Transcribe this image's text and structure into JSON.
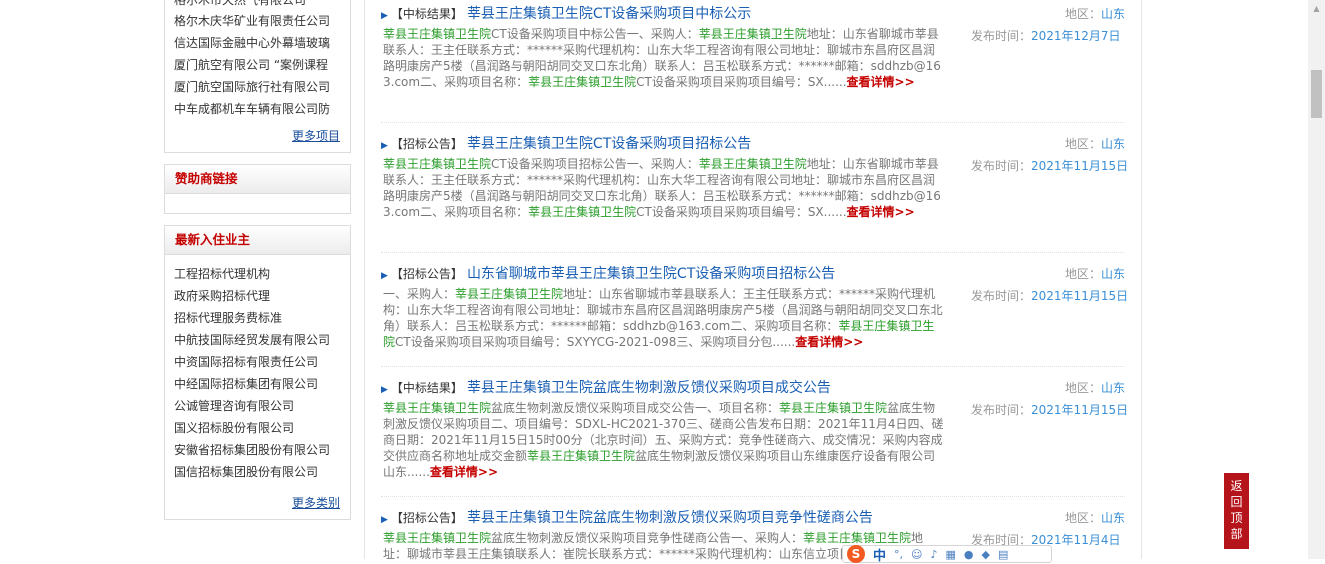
{
  "sidebar": {
    "top_partial": "格尔木市天然气有限公司",
    "top_list": [
      "格尔木庆华矿业有限责任公司",
      "信达国际金融中心外幕墙玻璃",
      "厦门航空有限公司 “案例课程",
      "厦门航空国际旅行社有限公司",
      "中车成都机车车辆有限公司防"
    ],
    "more_projects": "更多项目",
    "sponsor_title": "赞助商链接",
    "new_title": "最新入住业主",
    "new_list": [
      "工程招标代理机构",
      "政府采购招标代理",
      "招标代理服务费标准",
      "中航技国际经贸发展有限公司",
      "中资国际招标有限责任公司",
      "中经国际招标集团有限公司",
      "公诚管理咨询有限公司",
      "国义招标股份有限公司",
      "安徽省招标集团股份有限公司",
      "国信招标集团股份有限公司"
    ],
    "more_categories": "更多类别"
  },
  "labels": {
    "region": "地区：",
    "publish_time": "发布时间：",
    "detail": "查看详情>>",
    "detail_split_a": "查看详",
    "detail_split_b": "情>>"
  },
  "items": [
    {
      "tag": "【中标结果】",
      "title": "莘县王庄集镇卫生院CT设备采购项目中标公示",
      "region": "山东",
      "date": "2021年12月7日",
      "summary": {
        "p1": "莘县王庄集镇卫生院",
        "p2": "CT设备采购项目中标公告一、采购人：",
        "p3": "莘县王庄集镇卫生院",
        "p4": "地址：山东省聊城市莘县联系人：王主任联系方式：******采购代理机构：山东大华工程咨询有限公司地址：聊城市东昌府区昌润路明康房产5楼（昌润路与朝阳胡同交叉口东北角）联系人：吕玉松联系方式：******邮箱：sddhzb@163.com二、采购项目名称：",
        "p5": "莘县王庄集镇卫生院",
        "p6": "CT设备采购项目采购项目编号：SX......"
      }
    },
    {
      "tag": "【招标公告】",
      "title": "莘县王庄集镇卫生院CT设备采购项目招标公告",
      "region": "山东",
      "date": "2021年11月15日",
      "summary": {
        "p1": "莘县王庄集镇卫生院",
        "p2": "CT设备采购项目招标公告一、采购人：",
        "p3": "莘县王庄集镇卫生院",
        "p4": "地址：山东省聊城市莘县联系人：王主任联系方式：******采购代理机构：山东大华工程咨询有限公司地址：聊城市东昌府区昌润路明康房产5楼（昌润路与朝阳胡同交叉口东北角）联系人：吕玉松联系方式：******邮箱：sddhzb@163.com二、采购项目名称：",
        "p5": "莘县王庄集镇卫生院",
        "p6": "CT设备采购项目采购项目编号：SX......"
      }
    },
    {
      "tag": "【招标公告】",
      "title": "山东省聊城市莘县王庄集镇卫生院CT设备采购项目招标公告",
      "region": "山东",
      "date": "2021年11月15日",
      "summary": {
        "p1": "一、采购人：",
        "p2": "莘县王庄集镇卫生院",
        "p3": "地址：山东省聊城市莘县联系人：王主任联系方式：******采购代理机构：山东大华工程咨询有限公司地址：聊城市东昌府区昌润路明康房产5楼（昌润路与朝阳胡同交叉口东北角）联系人：吕玉松联系方式：******邮箱：sddhzb@163.com二、采购项目名称：",
        "p4": "莘县王庄集镇卫生院",
        "p5": "CT设备采购项目采购项目编号：SXYYCG-2021-098三、采购项目分包......"
      }
    },
    {
      "tag": "【中标结果】",
      "title": "莘县王庄集镇卫生院盆底生物刺激反馈仪采购项目成交公告",
      "region": "山东",
      "date": "2021年11月15日",
      "summary": {
        "p1": "莘县王庄集镇卫生院",
        "p2": "盆底生物刺激反馈仪采购项目成交公告一、项目名称：",
        "p3": "莘县王庄集镇卫生院",
        "p4": "盆底生物刺激反馈仪采购项目二、项目编号：SDXL-HC2021-370三、磋商公告发布日期：2021年11月4日四、磋商日期：2021年11月15日15时00分（北京时间）五、采购方式：竞争性磋商六、成交情况：采购内容成交供应商名称地址成交金额",
        "p5": "莘县王庄集镇卫生院",
        "p6": "盆底生物刺激反馈仪采购项目山东维康医疗设备有限公司山东......"
      }
    },
    {
      "tag": "【招标公告】",
      "title": "莘县王庄集镇卫生院盆底生物刺激反馈仪采购项目竞争性磋商公告",
      "region": "山东",
      "date": "2021年11月4日",
      "summary": {
        "p1": "莘县王庄集镇卫生院",
        "p2": "盆底生物刺激反馈仪采购项目竞争性磋商公告一、采购人：",
        "p3": "莘县王庄集镇卫生院",
        "p4": "地址：聊城市莘县王庄集镇联系人：崔院长联系方式：******采购代理机构：山东信立项目"
      }
    }
  ],
  "back_top": "返回顶部",
  "ime": {
    "logo": "S",
    "mode": "中"
  }
}
